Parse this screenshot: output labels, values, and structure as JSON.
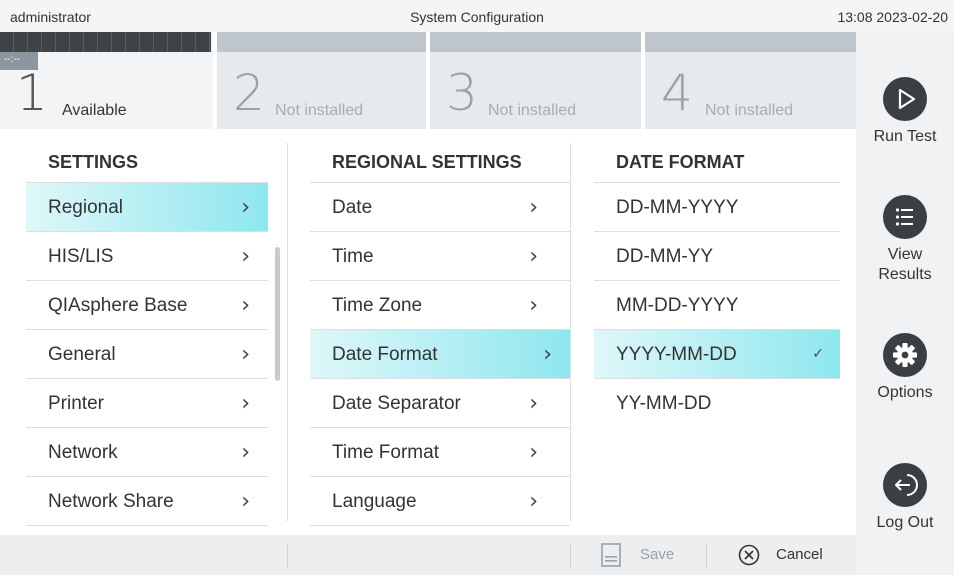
{
  "topbar": {
    "user": "administrator",
    "title": "System Configuration",
    "clock": "13:08 2023-02-20"
  },
  "modules": [
    {
      "number": "1",
      "status": "Available",
      "sub": "--:--"
    },
    {
      "number": "2",
      "status": "Not installed"
    },
    {
      "number": "3",
      "status": "Not installed"
    },
    {
      "number": "4",
      "status": "Not installed"
    }
  ],
  "nav": {
    "run_test": "Run Test",
    "view_results_1": "View",
    "view_results_2": "Results",
    "options": "Options",
    "log_out": "Log Out"
  },
  "settings": {
    "header": "SETTINGS",
    "items": [
      "Regional",
      "HIS/LIS",
      "QIAsphere Base",
      "General",
      "Printer",
      "Network",
      "Network Share"
    ]
  },
  "regional": {
    "header": "REGIONAL SETTINGS",
    "items": [
      "Date",
      "Time",
      "Time Zone",
      "Date Format",
      "Date Separator",
      "Time Format",
      "Language"
    ]
  },
  "date_format": {
    "header": "DATE FORMAT",
    "items": [
      "DD-MM-YYYY",
      "DD-MM-YY",
      "MM-DD-YYYY",
      "YYYY-MM-DD",
      "YY-MM-DD"
    ],
    "selected": "YYYY-MM-DD"
  },
  "bottom": {
    "save": "Save",
    "cancel": "Cancel"
  },
  "colors": {
    "selection": "#8ee7ee",
    "nav_icon": "#3b3f44"
  }
}
